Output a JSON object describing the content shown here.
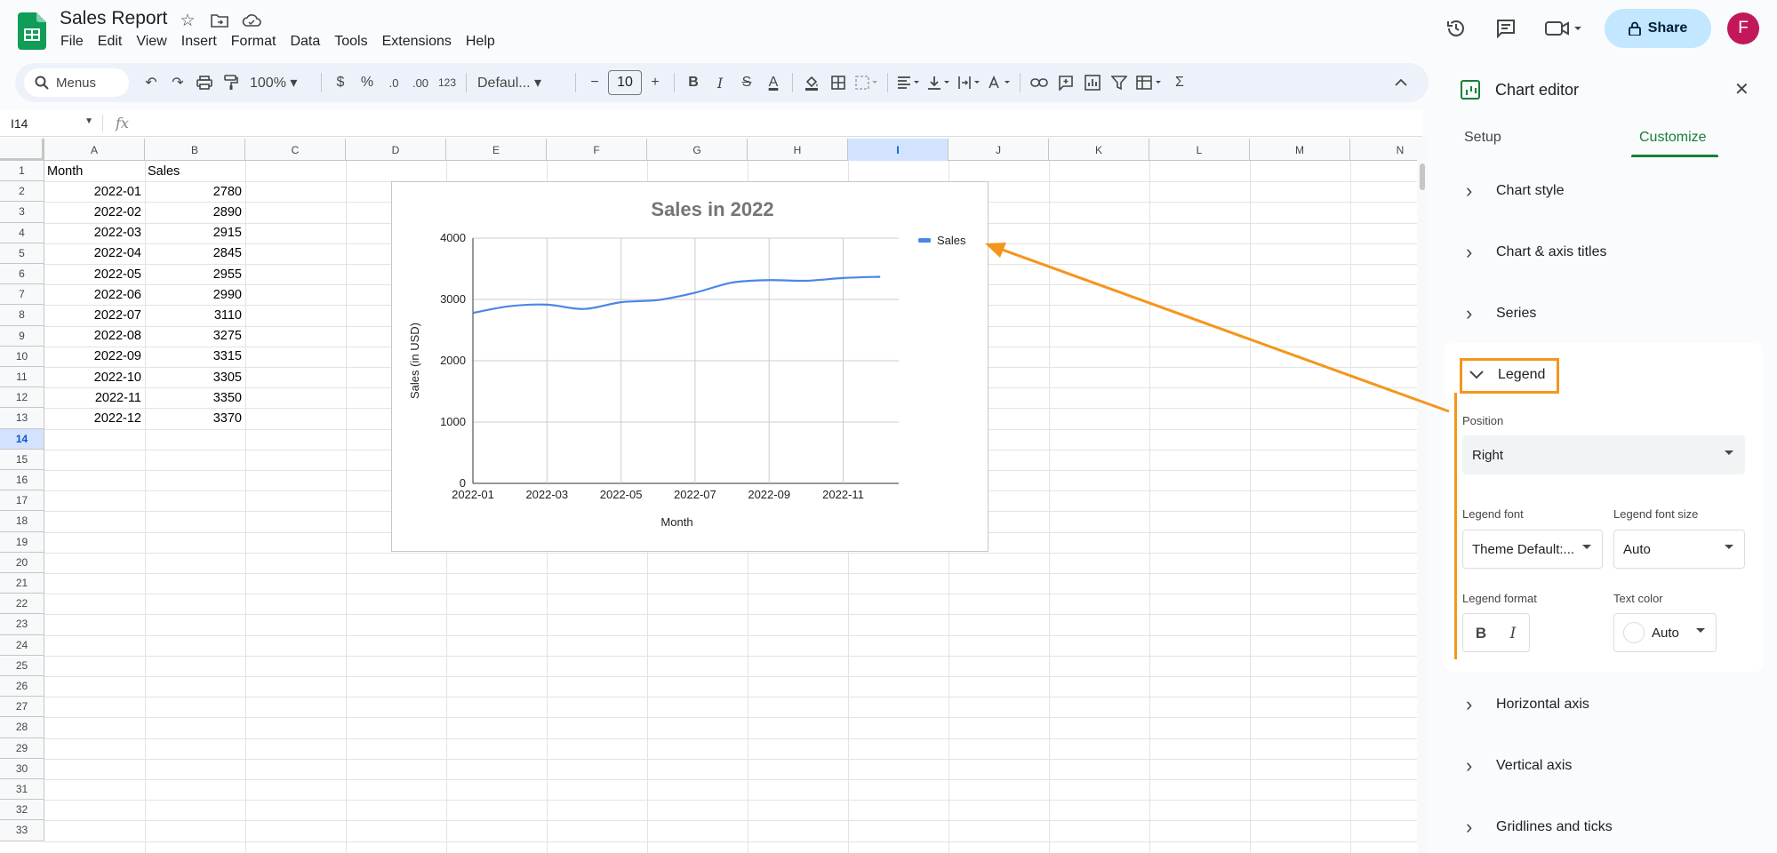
{
  "app": {
    "doc_title": "Sales Report",
    "menus": [
      "File",
      "Edit",
      "View",
      "Insert",
      "Format",
      "Data",
      "Tools",
      "Extensions",
      "Help"
    ],
    "share_label": "Share",
    "avatar_letter": "F",
    "brand_color": "#188038",
    "accent_color": "#f4961d"
  },
  "toolbar": {
    "menus_label": "Menus",
    "zoom": "100%",
    "currency": "$",
    "percent": "%",
    "dec_decrease": ".0",
    "dec_increase": ".00",
    "number_format": "123",
    "font": "Defaul...",
    "font_size": "10",
    "bold": "B",
    "italic": "I",
    "strike": "S",
    "text_color": "A"
  },
  "formula_bar": {
    "name_box": "I14",
    "fx": "fx"
  },
  "grid": {
    "columns": [
      "A",
      "B",
      "C",
      "D",
      "E",
      "F",
      "G",
      "H",
      "I",
      "J",
      "K",
      "L",
      "M",
      "N"
    ],
    "selected_column": "I",
    "row_count": 33,
    "selected_row": 14,
    "header": [
      "Month",
      "Sales"
    ],
    "rows": [
      [
        "2022-01",
        "2780"
      ],
      [
        "2022-02",
        "2890"
      ],
      [
        "2022-03",
        "2915"
      ],
      [
        "2022-04",
        "2845"
      ],
      [
        "2022-05",
        "2955"
      ],
      [
        "2022-06",
        "2990"
      ],
      [
        "2022-07",
        "3110"
      ],
      [
        "2022-08",
        "3275"
      ],
      [
        "2022-09",
        "3315"
      ],
      [
        "2022-10",
        "3305"
      ],
      [
        "2022-11",
        "3350"
      ],
      [
        "2022-12",
        "3370"
      ]
    ]
  },
  "chart_data": {
    "type": "line",
    "title": "Sales in 2022",
    "xlabel": "Month",
    "ylabel": "Sales (in USD)",
    "categories": [
      "2022-01",
      "2022-02",
      "2022-03",
      "2022-04",
      "2022-05",
      "2022-06",
      "2022-07",
      "2022-08",
      "2022-09",
      "2022-10",
      "2022-11",
      "2022-12"
    ],
    "x_tick_labels": [
      "2022-01",
      "2022-03",
      "2022-05",
      "2022-07",
      "2022-09",
      "2022-11"
    ],
    "y_ticks": [
      "0",
      "1000",
      "2000",
      "3000",
      "4000"
    ],
    "ylim": [
      0,
      4000
    ],
    "grid": true,
    "legend": "right",
    "series": [
      {
        "name": "Sales",
        "color": "#4a86e8",
        "values": [
          2780,
          2890,
          2915,
          2845,
          2955,
          2990,
          3110,
          3275,
          3315,
          3305,
          3350,
          3370
        ]
      }
    ]
  },
  "panel": {
    "title": "Chart editor",
    "tabs": [
      "Setup",
      "Customize"
    ],
    "active_tab": "Customize",
    "sections_top": [
      "Chart style",
      "Chart & axis titles",
      "Series"
    ],
    "legend": {
      "title": "Legend",
      "position_label": "Position",
      "position_value": "Right",
      "font_label": "Legend font",
      "font_value": "Theme Default:...",
      "font_size_label": "Legend font size",
      "font_size_value": "Auto",
      "format_label": "Legend format",
      "bold": "B",
      "italic": "I",
      "text_color_label": "Text color",
      "text_color_value": "Auto"
    },
    "sections_bottom": [
      "Horizontal axis",
      "Vertical axis",
      "Gridlines and ticks"
    ]
  }
}
